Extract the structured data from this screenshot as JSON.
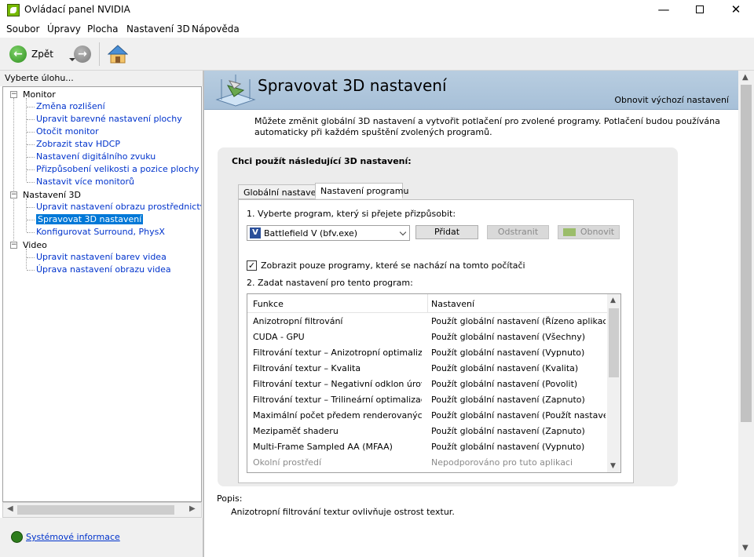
{
  "window": {
    "title": "Ovládací panel NVIDIA",
    "minimize_glyph": "—",
    "close_glyph": "✕"
  },
  "menu": [
    "Soubor",
    "Úpravy",
    "Plocha",
    "Nastavení 3D",
    "Nápověda"
  ],
  "toolbar": {
    "back_label": "Zpět",
    "icons": [
      "back-arrow-icon",
      "forward-arrow-icon",
      "home-icon"
    ]
  },
  "left": {
    "header": "Vyberte úlohu...",
    "tree": [
      {
        "label": "Monitor",
        "level": 0,
        "expanded": true
      },
      {
        "label": "Změna rozlišení",
        "level": 1
      },
      {
        "label": "Upravit barevné nastavení plochy",
        "level": 1
      },
      {
        "label": "Otočit monitor",
        "level": 1
      },
      {
        "label": "Zobrazit stav HDCP",
        "level": 1
      },
      {
        "label": "Nastavení digitálního zvuku",
        "level": 1
      },
      {
        "label": "Přizpůsobení velikosti a pozice plochy",
        "level": 1
      },
      {
        "label": "Nastavit více monitorů",
        "level": 1
      },
      {
        "label": "Nastavení 3D",
        "level": 0,
        "expanded": true
      },
      {
        "label": "Upravit nastavení obrazu prostřednictvím r",
        "level": 1
      },
      {
        "label": "Spravovat 3D nastavení",
        "level": 1,
        "selected": true
      },
      {
        "label": "Konfigurovat Surround, PhysX",
        "level": 1
      },
      {
        "label": "Video",
        "level": 0,
        "expanded": true
      },
      {
        "label": "Upravit nastavení barev videa",
        "level": 1
      },
      {
        "label": "Úprava nastavení obrazu videa",
        "level": 1
      }
    ],
    "system_info_link": "Systémové informace"
  },
  "main": {
    "title": "Spravovat 3D nastavení",
    "restore_defaults": "Obnovit výchozí nastavení",
    "description": "Můžete změnit globální 3D nastavení a vytvořit potlačení pro zvolené programy. Potlačení budou používána automaticky při každém spuštění zvolených programů.",
    "group_title": "Chci použít následující 3D nastavení:",
    "tabs": [
      {
        "label": "Globální nastavení",
        "active": false
      },
      {
        "label": "Nastavení programu",
        "active": true
      }
    ],
    "step1_label": "1. Vyberte program, který si přejete přizpůsobit:",
    "selected_program": "Battlefield V (bfv.exe)",
    "buttons": {
      "add": "Přidat",
      "remove": "Odstranit",
      "restore": "Obnovit"
    },
    "checkbox_label": "Zobrazit pouze programy, které se nachází na tomto počítači",
    "checkbox_checked": true,
    "step2_label": "2. Zadat nastavení pro tento program:",
    "columns": [
      "Funkce",
      "Nastavení"
    ],
    "rows": [
      {
        "feature": "Anizotropní filtrování",
        "setting": "Použít globální nastavení (Řízeno aplikací)"
      },
      {
        "feature": "CUDA - GPU",
        "setting": "Použít globální nastavení (Všechny)"
      },
      {
        "feature": "Filtrování textur – Anizotropní optimalizac...",
        "setting": "Použít globální nastavení (Vypnuto)"
      },
      {
        "feature": "Filtrování textur – Kvalita",
        "setting": "Použít globální nastavení (Kvalita)"
      },
      {
        "feature": "Filtrování textur – Negativní odklon úrovn...",
        "setting": "Použít globální nastavení (Povolit)"
      },
      {
        "feature": "Filtrování textur – Trilineární optimalizace",
        "setting": "Použít globální nastavení (Zapnuto)"
      },
      {
        "feature": "Maximální počet předem renderovaných s...",
        "setting": "Použít globální nastavení (Použít nastavení..."
      },
      {
        "feature": "Mezipaměť shaderu",
        "setting": "Použít globální nastavení (Zapnuto)"
      },
      {
        "feature": "Multi-Frame Sampled AA (MFAA)",
        "setting": "Použít globální nastavení (Vypnuto)"
      },
      {
        "feature": "Okolní prostředí",
        "setting": "Nepodporováno pro tuto aplikaci",
        "disabled": true
      }
    ],
    "popis_label": "Popis:",
    "popis_text": "Anizotropní filtrování textur ovlivňuje ostrost textur."
  },
  "colors": {
    "selection": "#0078d7",
    "link": "#0033cc",
    "banner": "#b8cde0",
    "nvidia_green": "#76b900"
  }
}
